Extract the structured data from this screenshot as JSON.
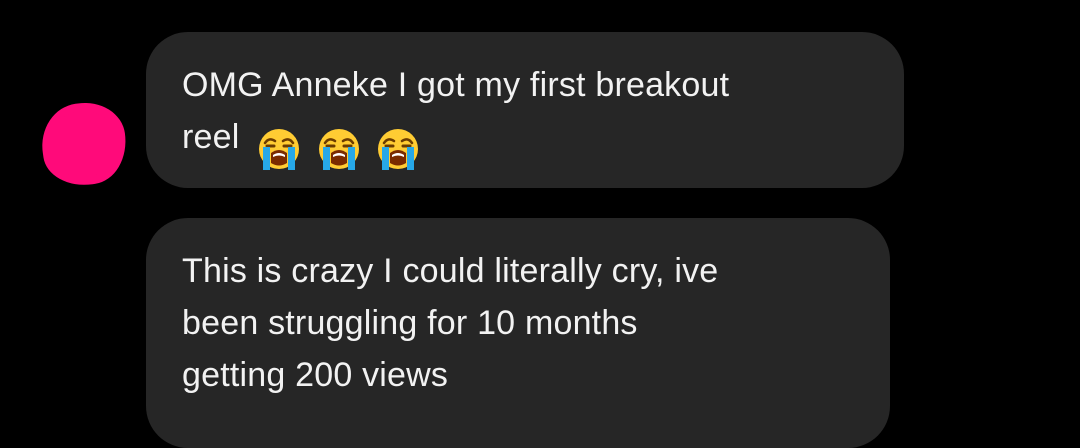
{
  "conversation": {
    "messages": [
      {
        "lines": [
          "OMG Anneke I got my first breakout",
          "reel"
        ],
        "emojis": [
          "loudly-crying-face-icon",
          "loudly-crying-face-icon",
          "loudly-crying-face-icon"
        ]
      },
      {
        "lines": [
          "This is crazy I could literally cry, ive",
          "been struggling for 10 months",
          "getting 200 views"
        ]
      }
    ]
  },
  "colors": {
    "background": "#000000",
    "bubble": "#262626",
    "text": "#f2f2f2",
    "avatar": "#ff0a7a"
  }
}
